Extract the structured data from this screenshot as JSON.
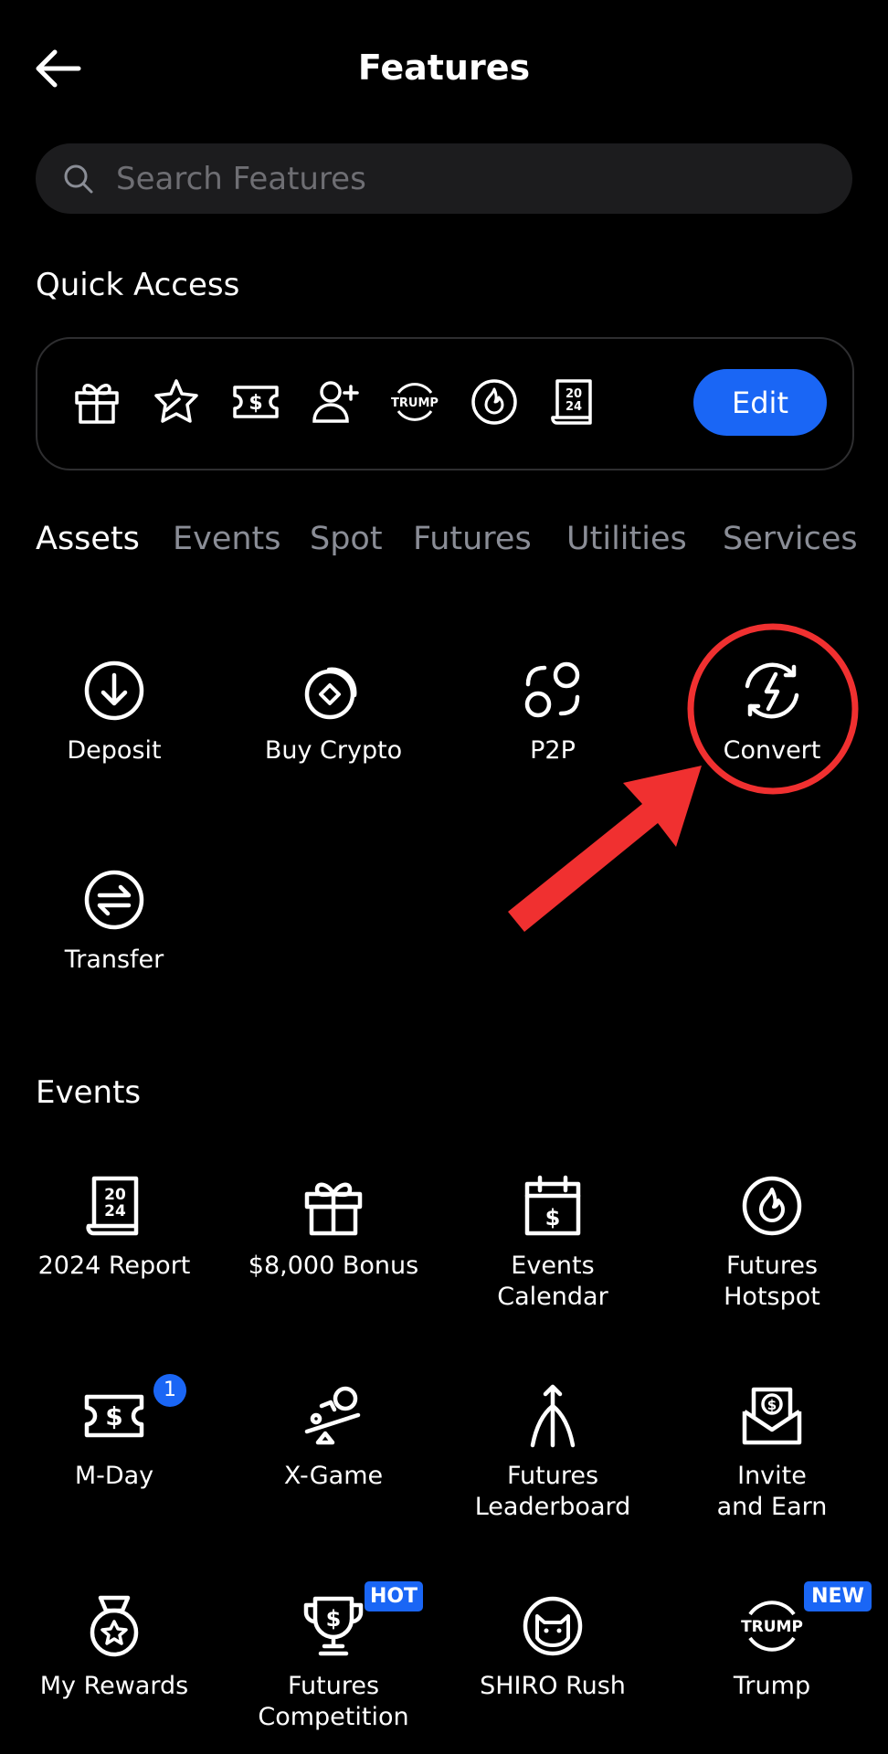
{
  "header": {
    "title": "Features"
  },
  "search": {
    "placeholder": "Search Features"
  },
  "quick_access": {
    "title": "Quick Access",
    "icons": [
      "gift-icon",
      "star-badge-icon",
      "ticket-dollar-icon",
      "add-user-icon",
      "trump-icon",
      "flame-icon",
      "report-2024-icon"
    ],
    "edit_label": "Edit"
  },
  "tabs": [
    "Assets",
    "Events",
    "Spot",
    "Futures",
    "Utilities",
    "Services"
  ],
  "assets": {
    "items": [
      {
        "label": "Deposit",
        "icon": "deposit-icon"
      },
      {
        "label": "Buy Crypto",
        "icon": "buy-crypto-icon"
      },
      {
        "label": "P2P",
        "icon": "p2p-icon"
      },
      {
        "label": "Convert",
        "icon": "convert-icon"
      },
      {
        "label": "Transfer",
        "icon": "transfer-icon"
      }
    ]
  },
  "events": {
    "heading": "Events",
    "items": [
      {
        "label": "2024 Report",
        "icon": "report-2024-icon"
      },
      {
        "label": "$8,000 Bonus",
        "icon": "gift-icon"
      },
      {
        "label": "Events\nCalendar",
        "icon": "calendar-dollar-icon"
      },
      {
        "label": "Futures\nHotspot",
        "icon": "flame-icon"
      },
      {
        "label": "M-Day",
        "icon": "ticket-dollar-icon",
        "badge": "1"
      },
      {
        "label": "X-Game",
        "icon": "x-game-icon"
      },
      {
        "label": "Futures\nLeaderboard",
        "icon": "leaderboard-icon"
      },
      {
        "label": "Invite\nand Earn",
        "icon": "invite-envelope-icon"
      },
      {
        "label": "My Rewards",
        "icon": "medal-icon"
      },
      {
        "label": "Futures\nCompetition",
        "icon": "trophy-icon",
        "tag": "HOT"
      },
      {
        "label": "SHIRO Rush",
        "icon": "cat-icon"
      },
      {
        "label": "Trump",
        "icon": "trump-icon",
        "tag": "NEW"
      }
    ]
  },
  "annotation": {
    "color": "#f03030"
  }
}
